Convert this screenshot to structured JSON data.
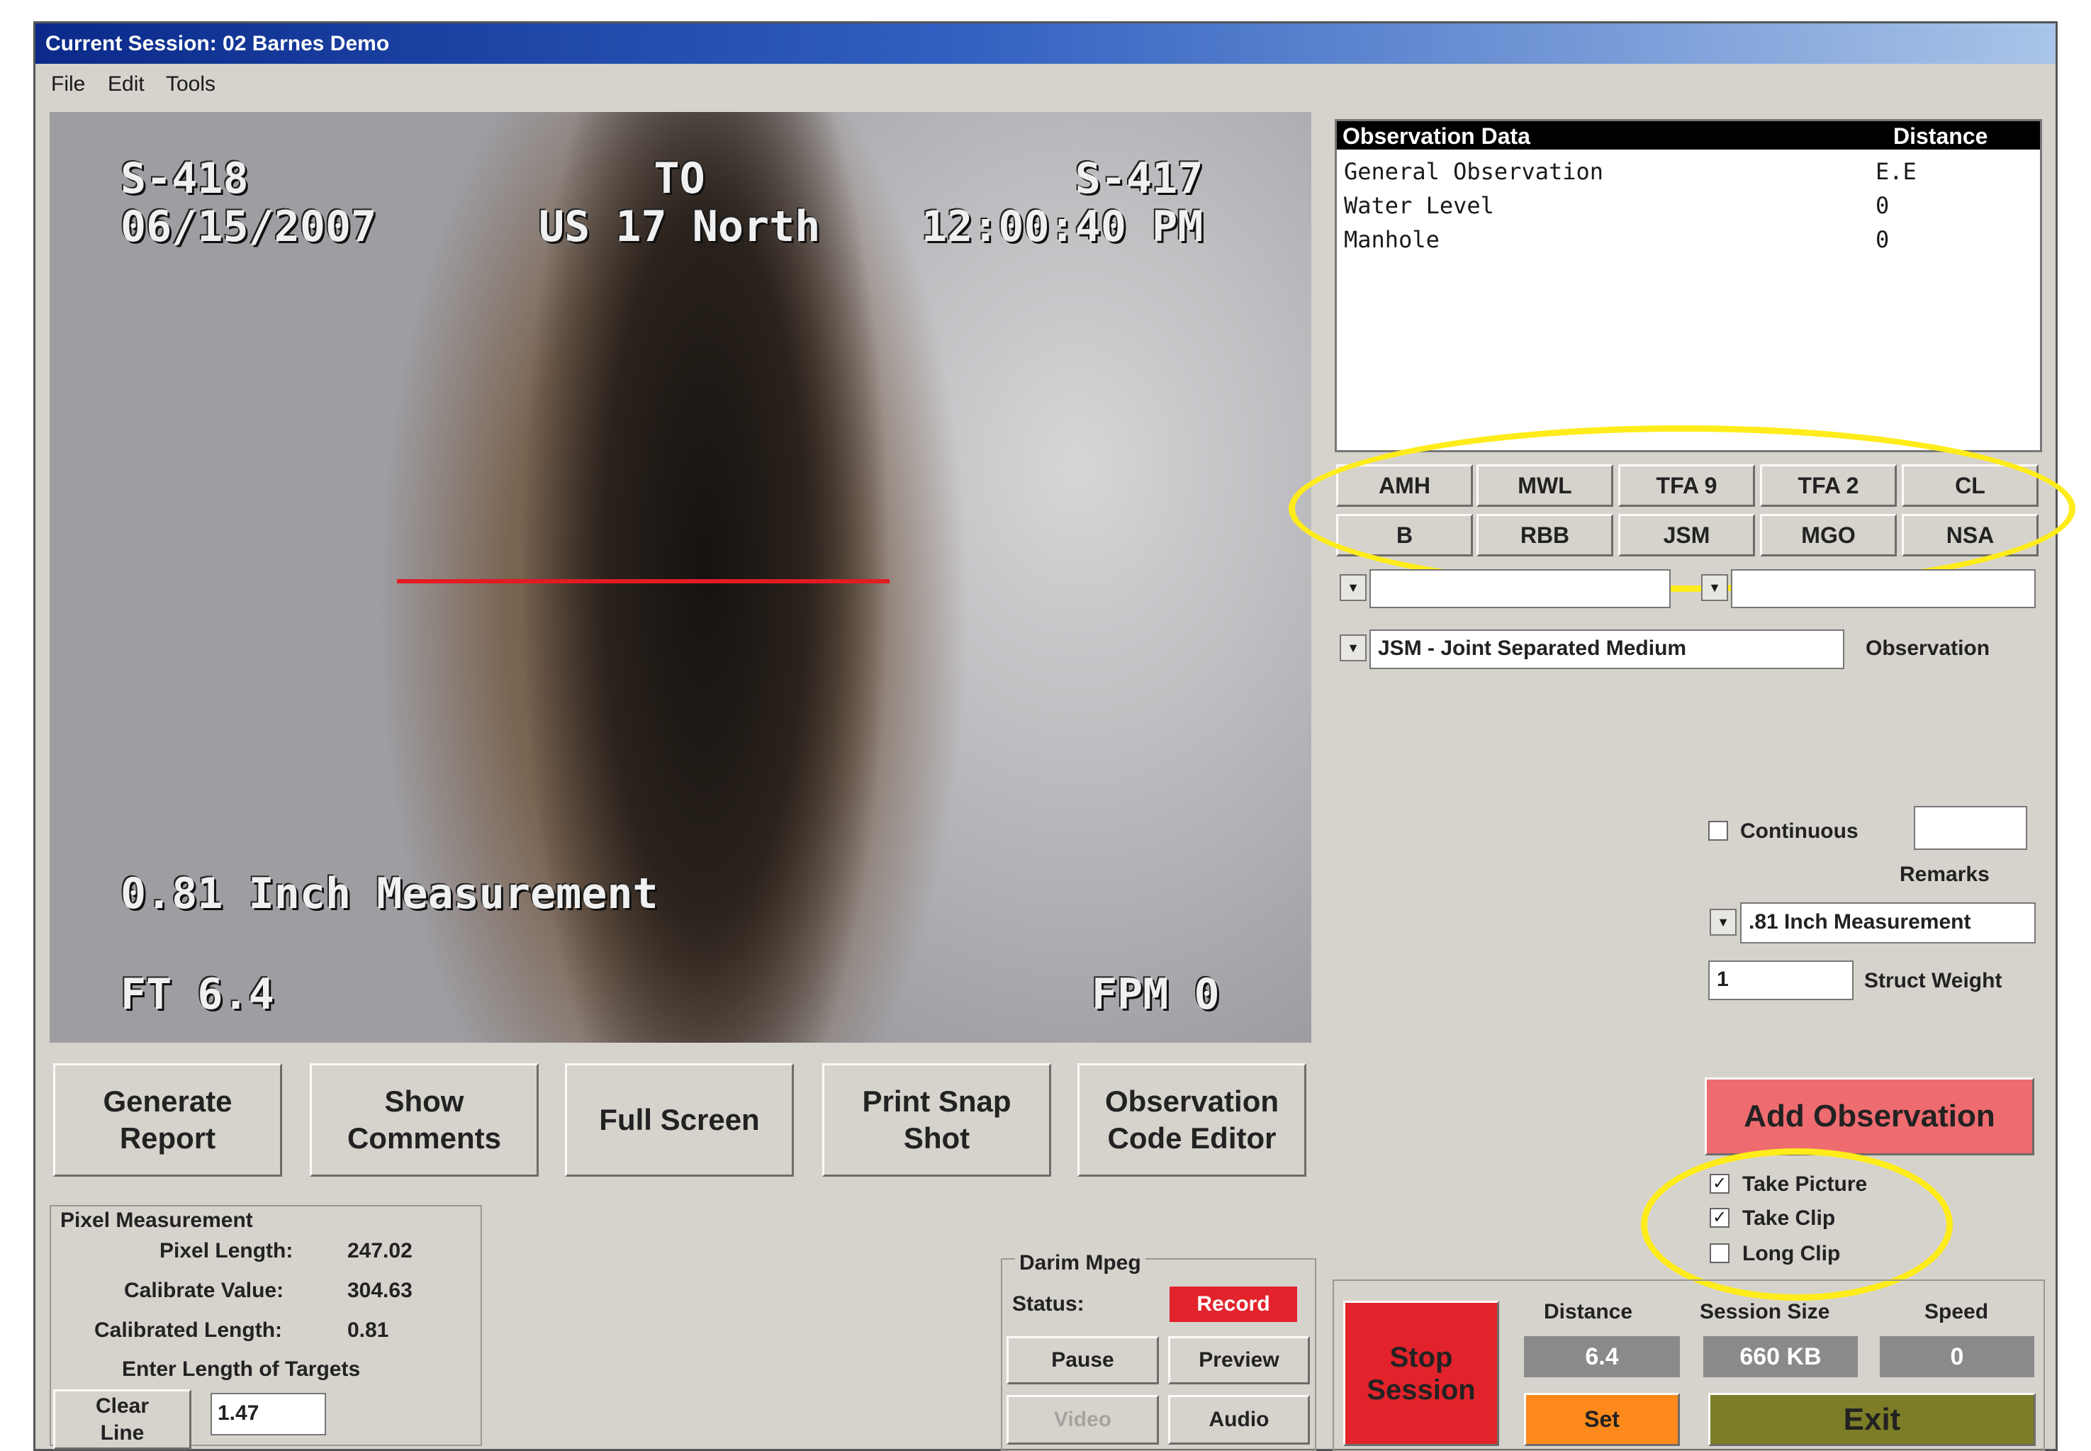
{
  "window": {
    "title": "Current Session: 02 Barnes Demo",
    "menu": [
      "File",
      "Edit",
      "Tools"
    ]
  },
  "video": {
    "overlay_top_left": "S-418\n06/15/2007",
    "overlay_top_center": "TO\nUS 17 North",
    "overlay_top_right": "S-417\n12:00:40 PM",
    "overlay_measure": "0.81 Inch Measurement",
    "overlay_bottom_left": "FT 6.4",
    "overlay_bottom_right": "FPM 0",
    "measure_line_color": "#e31b23"
  },
  "actions": [
    {
      "label": "Generate\nReport"
    },
    {
      "label": "Show\nComments"
    },
    {
      "label": "Full Screen"
    },
    {
      "label": "Print Snap\nShot"
    },
    {
      "label": "Observation\nCode Editor"
    }
  ],
  "observation_table": {
    "headers": [
      "Observation Data",
      "Distance"
    ],
    "rows": [
      {
        "name": "General Observation",
        "distance": "E.E"
      },
      {
        "name": "Water Level",
        "distance": "0"
      },
      {
        "name": "Manhole",
        "distance": "0"
      }
    ]
  },
  "code_buttons": {
    "row1": [
      "AMH",
      "MWL",
      "TFA 9",
      "TFA 2",
      "CL"
    ],
    "row2": [
      "B",
      "RBB",
      "JSM",
      "MGO",
      "NSA"
    ]
  },
  "observation": {
    "selected": "JSM - Joint Separated Medium",
    "label": "Observation"
  },
  "continuous": {
    "label": "Continuous",
    "checked": false
  },
  "remarks": {
    "label": "Remarks",
    "value": ".81 Inch Measurement"
  },
  "struct_weight": {
    "label": "Struct Weight",
    "value": "1"
  },
  "add_observation": {
    "label": "Add Observation",
    "color": "#ee6b6f"
  },
  "capture_options": [
    {
      "label": "Take Picture",
      "checked": true
    },
    {
      "label": "Take Clip",
      "checked": true
    },
    {
      "label": "Long Clip",
      "checked": false
    }
  ],
  "pixel_measurement": {
    "title": "Pixel Measurement",
    "pixel_length_label": "Pixel Length:",
    "pixel_length": "247.02",
    "calibrate_label": "Calibrate Value:",
    "calibrate": "304.63",
    "calibrated_length_label": "Calibrated Length:",
    "calibrated_length": "0.81",
    "enter_label": "Enter Length of Targets",
    "clear_label": "Clear\nLine",
    "length_value": "1.47"
  },
  "mpeg": {
    "title": "Darim Mpeg",
    "status_label": "Status:",
    "status_value": "Record",
    "pause": "Pause",
    "preview": "Preview",
    "video": "Video",
    "audio": "Audio"
  },
  "session": {
    "stop_label": "Stop\nSession",
    "stop_color": "#e3232b",
    "distance_label": "Distance",
    "distance": "6.4",
    "size_label": "Session Size",
    "size": "660 KB",
    "speed_label": "Speed",
    "speed": "0",
    "set_label": "Set",
    "set_color": "#ff8a1c",
    "exit_label": "Exit",
    "exit_color": "#7d7d28"
  },
  "highlight_color": "#ffec1a"
}
